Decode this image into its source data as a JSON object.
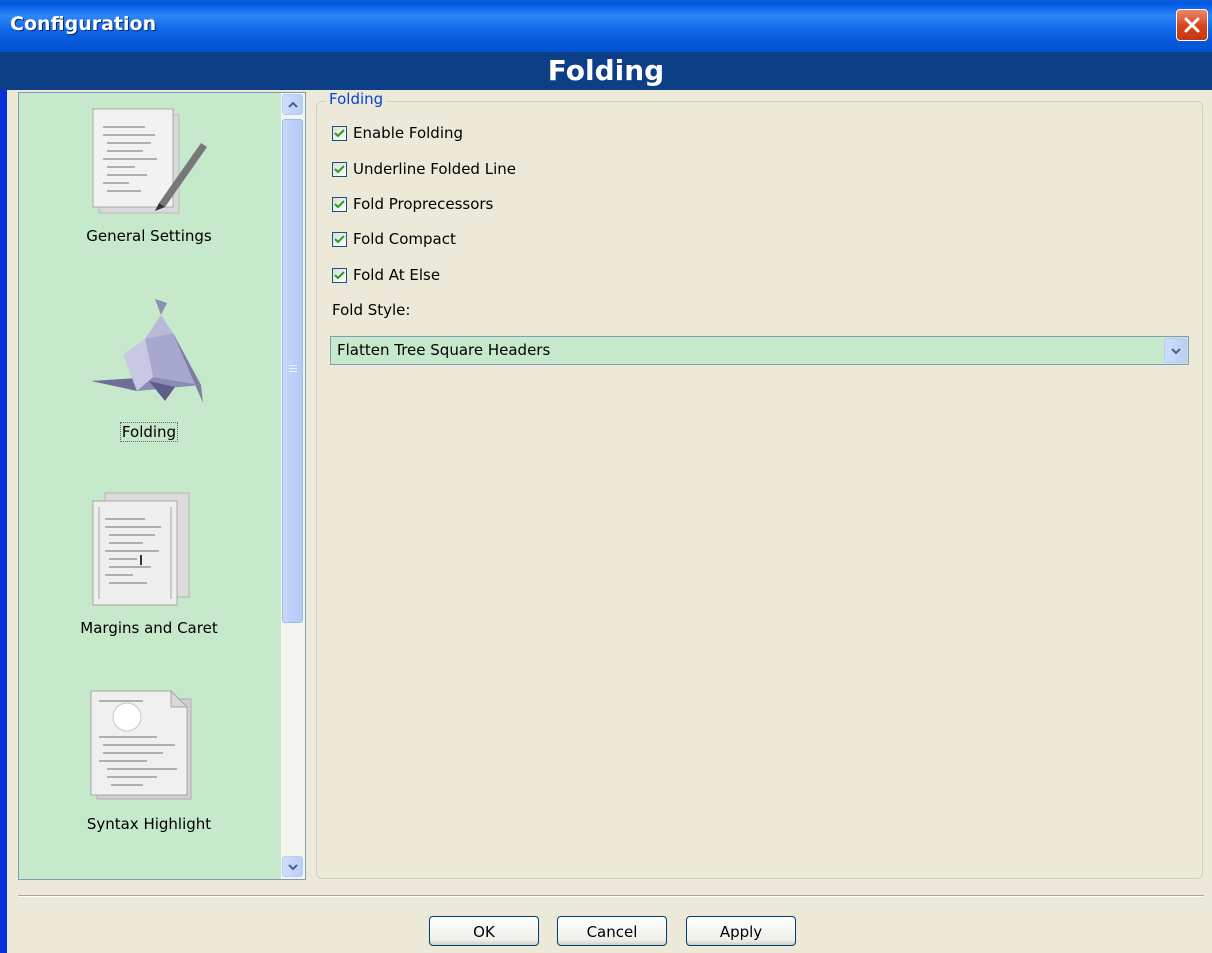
{
  "window": {
    "title": "Configuration"
  },
  "header": {
    "title": "Folding"
  },
  "sidebar": {
    "items": [
      {
        "label": "General Settings",
        "icon": "general-settings-icon"
      },
      {
        "label": "Folding",
        "icon": "folding-origami-icon",
        "selected": true
      },
      {
        "label": "Margins and Caret",
        "icon": "margins-caret-icon"
      },
      {
        "label": "Syntax Highlight",
        "icon": "syntax-highlight-icon"
      }
    ]
  },
  "group": {
    "title": "Folding",
    "checkboxes": [
      {
        "label": "Enable Folding",
        "checked": true
      },
      {
        "label": "Underline Folded Line",
        "checked": true
      },
      {
        "label": "Fold Proprecessors",
        "checked": true
      },
      {
        "label": "Fold Compact",
        "checked": true
      },
      {
        "label": "Fold At Else",
        "checked": true
      }
    ],
    "fold_style_label": "Fold Style:",
    "fold_style_value": "Flatten Tree Square Headers"
  },
  "buttons": {
    "ok": "OK",
    "cancel": "Cancel",
    "apply": "Apply"
  },
  "colors": {
    "titlebar": "#0058E3",
    "header_band": "#0D3F86",
    "panel_bg": "#C6E8CB",
    "dialog_bg": "#ECE9D8",
    "checkmark": "#21A121"
  }
}
